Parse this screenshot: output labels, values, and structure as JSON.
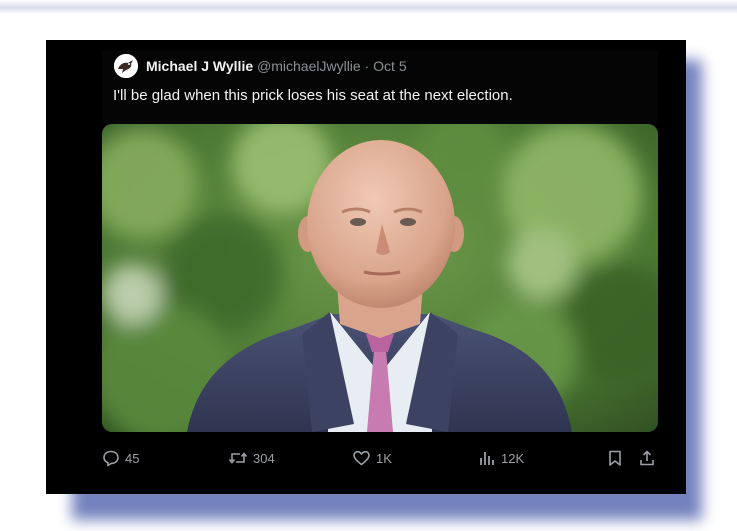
{
  "tweet": {
    "display_name": "Michael J Wyllie",
    "handle": "@michaelJwyllie",
    "separator": "·",
    "date": "Oct 5",
    "text": "I'll be glad when this prick loses his seat at the next election.",
    "avatar": "bird-silhouette-avatar",
    "photo": "photo-man-in-suit-pink-tie-green-foliage"
  },
  "actions": {
    "replies": "45",
    "reposts": "304",
    "likes": "1K",
    "views": "12K",
    "icons": [
      "reply-icon",
      "repost-icon",
      "like-icon",
      "views-icon",
      "bookmark-icon",
      "share-icon"
    ]
  },
  "colors": {
    "card_background": "#000000",
    "frame_shadow": "#5c6db3",
    "text_primary": "#f2f2f2",
    "text_secondary": "#8b9096",
    "tie": "#c87bb0",
    "suit": "#3b4262"
  }
}
